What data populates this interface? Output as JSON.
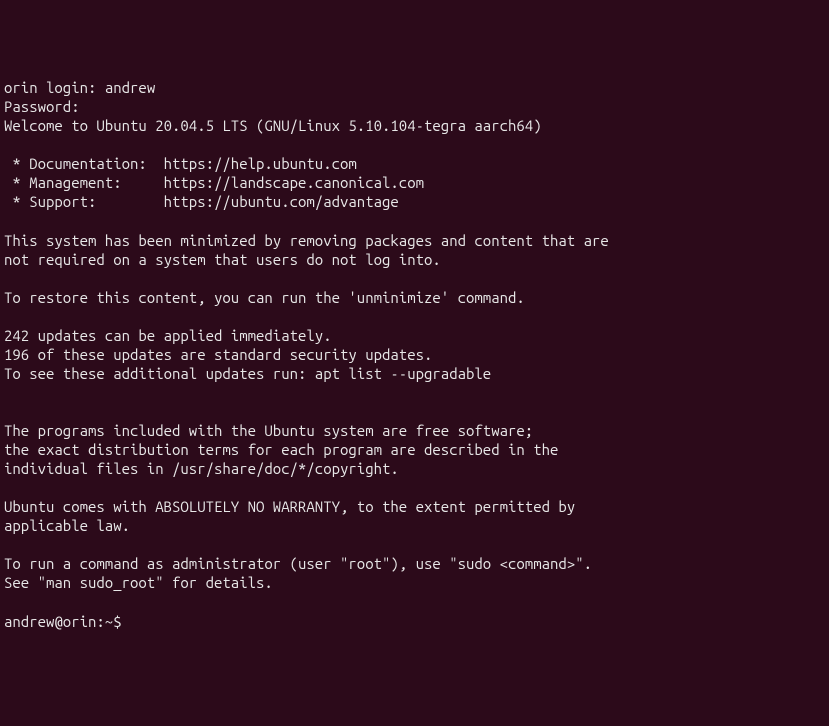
{
  "login": {
    "prompt": "orin login: ",
    "username": "andrew",
    "password_prompt": "Password:"
  },
  "welcome": "Welcome to Ubuntu 20.04.5 LTS (GNU/Linux 5.10.104-tegra aarch64)",
  "links": {
    "documentation": " * Documentation:  https://help.ubuntu.com",
    "management": " * Management:     https://landscape.canonical.com",
    "support": " * Support:        https://ubuntu.com/advantage"
  },
  "minimize": {
    "line1": "This system has been minimized by removing packages and content that are",
    "line2": "not required on a system that users do not log into.",
    "restore": "To restore this content, you can run the 'unminimize' command."
  },
  "updates": {
    "count": "242 updates can be applied immediately.",
    "security": "196 of these updates are standard security updates.",
    "see": "To see these additional updates run: apt list --upgradable"
  },
  "legal": {
    "line1": "The programs included with the Ubuntu system are free software;",
    "line2": "the exact distribution terms for each program are described in the",
    "line3": "individual files in /usr/share/doc/*/copyright.",
    "warranty1": "Ubuntu comes with ABSOLUTELY NO WARRANTY, to the extent permitted by",
    "warranty2": "applicable law."
  },
  "sudo": {
    "line1": "To run a command as administrator (user \"root\"), use \"sudo <command>\".",
    "line2": "See \"man sudo_root\" for details."
  },
  "prompt": "andrew@orin:~$ "
}
